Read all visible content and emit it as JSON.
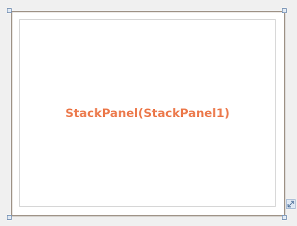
{
  "designer": {
    "panel": {
      "caption": "StackPanel(StackPanel1)"
    },
    "colors": {
      "background": "#f0f0f0",
      "surface": "#ffffff",
      "surface_border": "#a59a8f",
      "caption": "#ec7b4e",
      "handle": "#7d97b8"
    },
    "icons": {
      "resize_grip": "resize-diagonal-icon"
    }
  }
}
